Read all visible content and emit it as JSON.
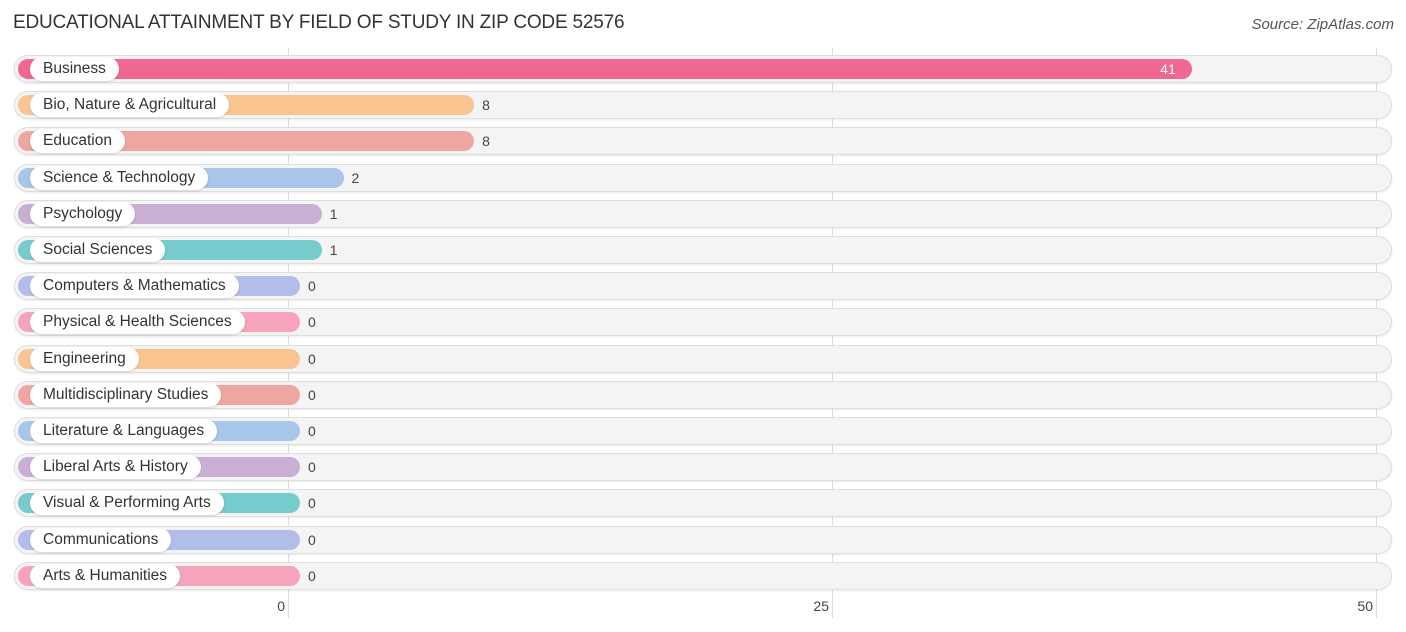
{
  "header": {
    "title": "EDUCATIONAL ATTAINMENT BY FIELD OF STUDY IN ZIP CODE 52576",
    "source": "Source: ZipAtlas.com"
  },
  "chart_data": {
    "type": "bar",
    "orientation": "horizontal",
    "title": "EDUCATIONAL ATTAINMENT BY FIELD OF STUDY IN ZIP CODE 52576",
    "xlabel": "",
    "ylabel": "",
    "xlim": [
      0,
      50
    ],
    "ticks": [
      0,
      25,
      50
    ],
    "tick_labels": [
      "0",
      "25",
      "50"
    ],
    "grid": true,
    "categories": [
      "Business",
      "Bio, Nature & Agricultural",
      "Education",
      "Science & Technology",
      "Psychology",
      "Social Sciences",
      "Computers & Mathematics",
      "Physical & Health Sciences",
      "Engineering",
      "Multidisciplinary Studies",
      "Literature & Languages",
      "Liberal Arts & History",
      "Visual & Performing Arts",
      "Communications",
      "Arts & Humanities"
    ],
    "values": [
      41,
      8,
      8,
      2,
      1,
      1,
      0,
      0,
      0,
      0,
      0,
      0,
      0,
      0,
      0
    ],
    "value_labels": [
      "41",
      "8",
      "8",
      "2",
      "1",
      "1",
      "0",
      "0",
      "0",
      "0",
      "0",
      "0",
      "0",
      "0",
      "0"
    ],
    "colors": [
      "#f06892",
      "#f9c48f",
      "#eea6a1",
      "#a8c6ea",
      "#c9afd3",
      "#78cbcc",
      "#b3bdea",
      "#f7a3bb",
      "#f9c48f",
      "#eea6a1",
      "#a8c6ea",
      "#c9afd3",
      "#78cbcc",
      "#b3bdea",
      "#f7a3bb"
    ]
  }
}
